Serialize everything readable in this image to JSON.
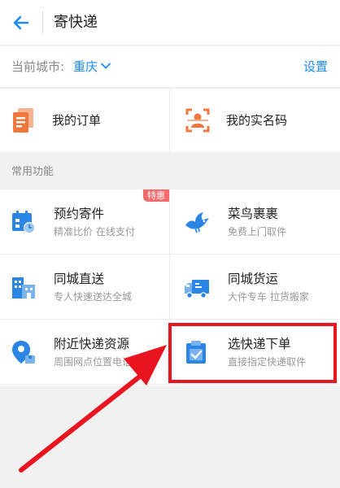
{
  "header": {
    "title": "寄快递"
  },
  "city_bar": {
    "label": "当前城市:",
    "city": "重庆",
    "settings": "设置"
  },
  "quick": [
    {
      "label": "我的订单",
      "icon": "document-icon"
    },
    {
      "label": "我的实名码",
      "icon": "qr-scan-icon"
    }
  ],
  "section_title": "常用功能",
  "features": [
    {
      "title": "预约寄件",
      "subtitle": "精准比价 在线支付",
      "badge": "特惠",
      "icon": "calendar-clock-icon"
    },
    {
      "title": "菜鸟裹裹",
      "subtitle": "免费上门取件",
      "icon": "bird-icon"
    },
    {
      "title": "同城直送",
      "subtitle": "专人快速送达全城",
      "icon": "buildings-icon"
    },
    {
      "title": "同城货运",
      "subtitle": "大件专车 拉货搬家",
      "icon": "truck-icon"
    },
    {
      "title": "附近快递资源",
      "subtitle": "周围网点位置电话",
      "icon": "map-pin-icon"
    },
    {
      "title": "选快递下单",
      "subtitle": "直接指定快递取件",
      "icon": "clipboard-check-icon"
    }
  ],
  "colors": {
    "accent": "#1a8cff",
    "orange": "#f0783c",
    "highlight": "#e8141f"
  }
}
